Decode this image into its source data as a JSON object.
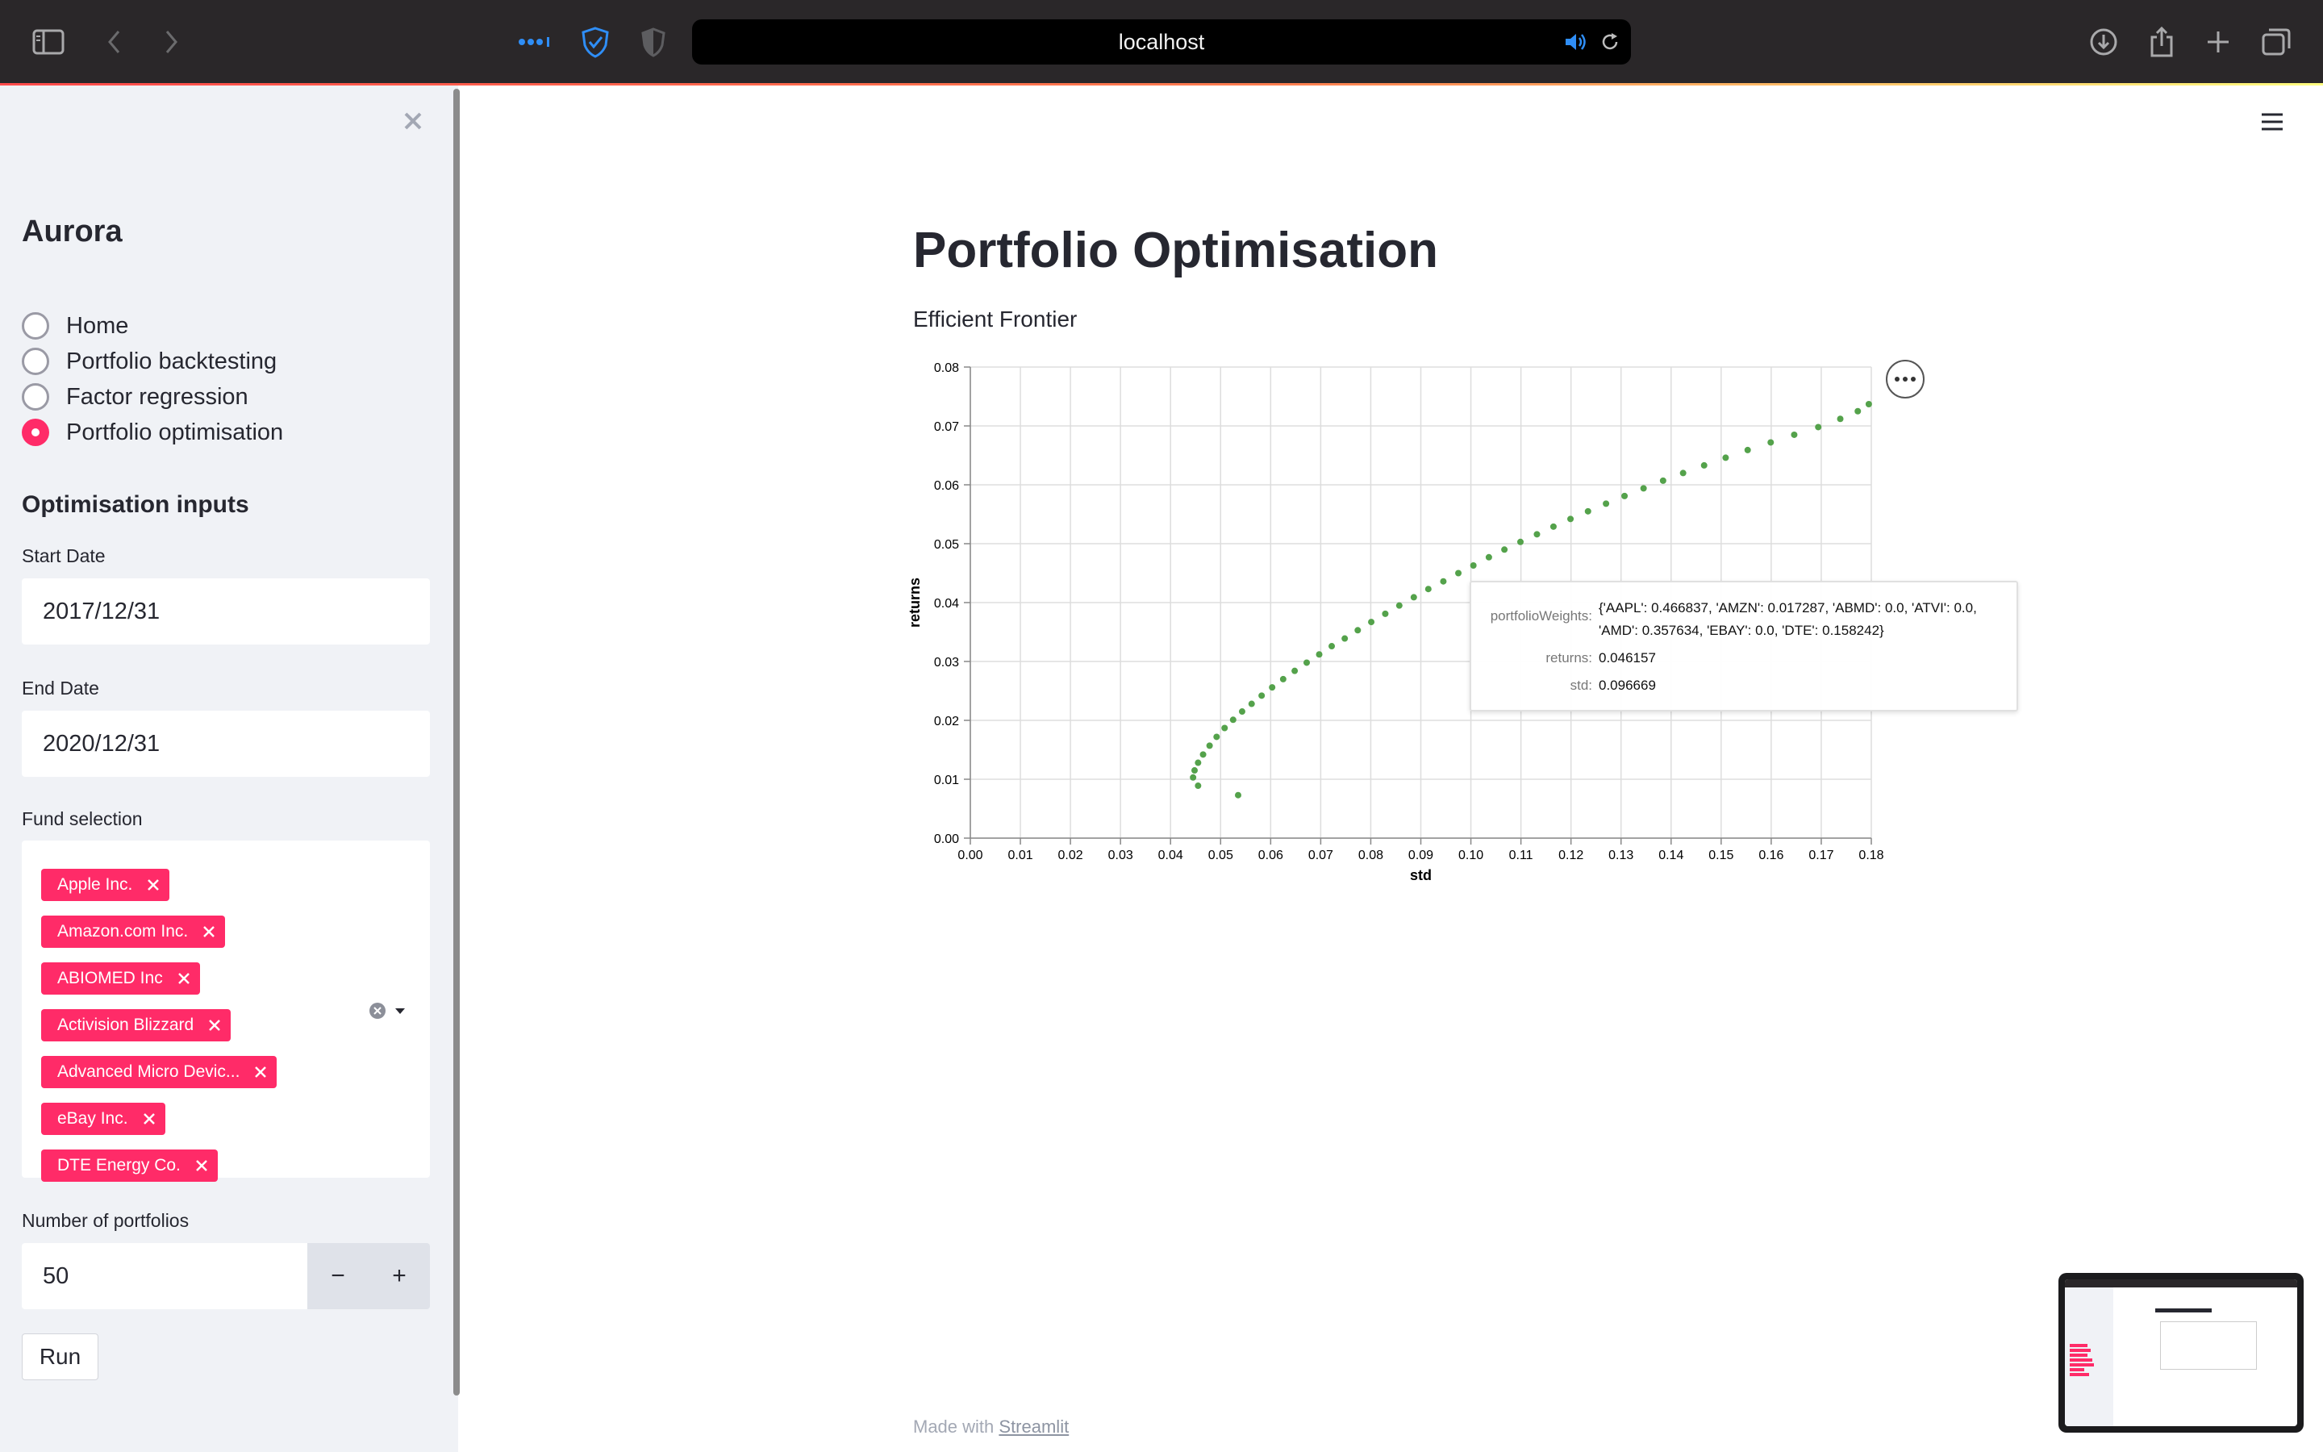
{
  "browser": {
    "url": "localhost"
  },
  "sidebar": {
    "app_title": "Aurora",
    "nav": [
      {
        "label": "Home",
        "selected": false
      },
      {
        "label": "Portfolio backtesting",
        "selected": false
      },
      {
        "label": "Factor regression",
        "selected": false
      },
      {
        "label": "Portfolio optimisation",
        "selected": true
      }
    ],
    "section_heading": "Optimisation inputs",
    "start_date": {
      "label": "Start Date",
      "value": "2017/12/31"
    },
    "end_date": {
      "label": "End Date",
      "value": "2020/12/31"
    },
    "fund_selection": {
      "label": "Fund selection",
      "chips": [
        "Apple Inc.",
        "Amazon.com Inc.",
        "ABIOMED Inc",
        "Activision Blizzard",
        "Advanced Micro Devic...",
        "eBay Inc.",
        "DTE Energy Co."
      ]
    },
    "num_portfolios": {
      "label": "Number of portfolios",
      "value": "50",
      "minus": "−",
      "plus": "+"
    },
    "run_label": "Run"
  },
  "main": {
    "title": "Portfolio Optimisation",
    "subtitle": "Efficient Frontier",
    "tooltip": {
      "weights_key": "portfolioWeights:",
      "weights_value": "{'AAPL': 0.466837, 'AMZN': 0.017287, 'ABMD': 0.0, 'ATVI': 0.0, 'AMD': 0.357634, 'EBAY': 0.0, 'DTE': 0.158242}",
      "returns_key": "returns:",
      "returns_value": "0.046157",
      "std_key": "std:",
      "std_value": "0.096669"
    },
    "footer_prefix": "Made with ",
    "footer_link": "Streamlit"
  },
  "colors": {
    "accent": "#ff2b68",
    "point": "#54a24b",
    "sidebar_bg": "#f0f2f6"
  },
  "chart_data": {
    "type": "scatter",
    "xlabel": "std",
    "ylabel": "returns",
    "xlim": [
      0,
      0.18
    ],
    "ylim": [
      0,
      0.08
    ],
    "x_ticks": [
      "0.00",
      "0.01",
      "0.02",
      "0.03",
      "0.04",
      "0.05",
      "0.06",
      "0.07",
      "0.08",
      "0.09",
      "0.10",
      "0.11",
      "0.12",
      "0.13",
      "0.14",
      "0.15",
      "0.16",
      "0.17",
      "0.18"
    ],
    "y_ticks": [
      "0.00",
      "0.01",
      "0.02",
      "0.03",
      "0.04",
      "0.05",
      "0.06",
      "0.07",
      "0.08"
    ],
    "grid": true,
    "points": [
      {
        "x": 0.0535,
        "y": 0.0073
      },
      {
        "x": 0.0455,
        "y": 0.0089
      },
      {
        "x": 0.0445,
        "y": 0.0103
      },
      {
        "x": 0.0448,
        "y": 0.0115
      },
      {
        "x": 0.0455,
        "y": 0.0128
      },
      {
        "x": 0.0465,
        "y": 0.0142
      },
      {
        "x": 0.0478,
        "y": 0.0157
      },
      {
        "x": 0.0492,
        "y": 0.0172
      },
      {
        "x": 0.0508,
        "y": 0.0187
      },
      {
        "x": 0.0525,
        "y": 0.0201
      },
      {
        "x": 0.0543,
        "y": 0.0215
      },
      {
        "x": 0.0562,
        "y": 0.0228
      },
      {
        "x": 0.0582,
        "y": 0.0242
      },
      {
        "x": 0.0603,
        "y": 0.0256
      },
      {
        "x": 0.0625,
        "y": 0.027
      },
      {
        "x": 0.0648,
        "y": 0.0284
      },
      {
        "x": 0.0672,
        "y": 0.0298
      },
      {
        "x": 0.0697,
        "y": 0.0312
      },
      {
        "x": 0.0722,
        "y": 0.0326
      },
      {
        "x": 0.0748,
        "y": 0.0339
      },
      {
        "x": 0.0774,
        "y": 0.0353
      },
      {
        "x": 0.0801,
        "y": 0.0367
      },
      {
        "x": 0.0829,
        "y": 0.0381
      },
      {
        "x": 0.0857,
        "y": 0.0395
      },
      {
        "x": 0.0886,
        "y": 0.0409
      },
      {
        "x": 0.0915,
        "y": 0.0423
      },
      {
        "x": 0.0945,
        "y": 0.0436
      },
      {
        "x": 0.0975,
        "y": 0.045
      },
      {
        "x": 0.1005,
        "y": 0.0463
      },
      {
        "x": 0.1036,
        "y": 0.0477
      },
      {
        "x": 0.1067,
        "y": 0.049
      },
      {
        "x": 0.1099,
        "y": 0.0503
      },
      {
        "x": 0.1132,
        "y": 0.0516
      },
      {
        "x": 0.1165,
        "y": 0.0529
      },
      {
        "x": 0.1199,
        "y": 0.0542
      },
      {
        "x": 0.1234,
        "y": 0.0555
      },
      {
        "x": 0.127,
        "y": 0.0568
      },
      {
        "x": 0.1307,
        "y": 0.0581
      },
      {
        "x": 0.1345,
        "y": 0.0594
      },
      {
        "x": 0.1384,
        "y": 0.0607
      },
      {
        "x": 0.1424,
        "y": 0.062
      },
      {
        "x": 0.1466,
        "y": 0.0633
      },
      {
        "x": 0.1509,
        "y": 0.0646
      },
      {
        "x": 0.1553,
        "y": 0.0659
      },
      {
        "x": 0.1599,
        "y": 0.0672
      },
      {
        "x": 0.1646,
        "y": 0.0685
      },
      {
        "x": 0.1694,
        "y": 0.0698
      },
      {
        "x": 0.1738,
        "y": 0.0712
      },
      {
        "x": 0.1773,
        "y": 0.0725
      },
      {
        "x": 0.1795,
        "y": 0.0737
      }
    ]
  }
}
